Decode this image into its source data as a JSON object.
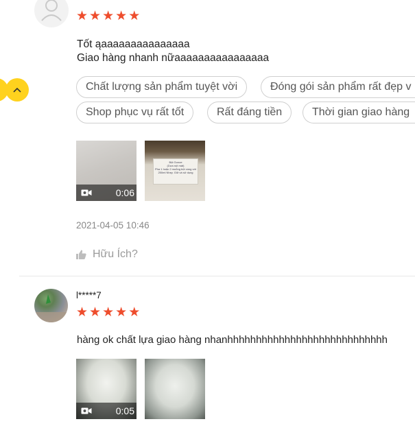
{
  "review1": {
    "rating": 5,
    "text_line1": "Tốt ąaaaaaaaaaaaaaaa",
    "text_line2": "Giao hàng nhanh nữaaaaaaaaaaaaaaaa",
    "tags": [
      "Chất lượng sản phẩm tuyệt vời",
      "Đóng gói sản phẩm rất đẹp v",
      "Shop phục vụ rất tốt",
      "Rất đáng tiền",
      "Thời gian giao hàng"
    ],
    "media": [
      {
        "type": "video",
        "duration": "0:06"
      },
      {
        "type": "image",
        "label_lines": [
          "Bột Gonoe",
          "(Dưa nút mát)",
          "Pha 1 hoặc 2 muỗng bột cùng với",
          "250ml Nhẹy. Giữ và sử dụng"
        ]
      }
    ],
    "date": "2021-04-05 10:46",
    "helpful_label": "Hữu Ích?"
  },
  "review2": {
    "username": "l*****7",
    "rating": 5,
    "text": "hàng ok chất lựa giao hàng nhanhhhhhhhhhhhhhhhhhhhhhhhhhhhh",
    "media": [
      {
        "type": "video",
        "duration": "0:05"
      },
      {
        "type": "image"
      }
    ]
  },
  "colors": {
    "star": "#ee4d2d",
    "scroll_button": "#ffd21e",
    "tag_border": "#cfcfcf",
    "meta_text": "#888888"
  },
  "icons": {
    "star": "star-icon",
    "video": "video-camera-icon",
    "thumbs_up": "thumbs-up-icon",
    "scroll_top": "chevron-up-icon",
    "avatar_default": "user-icon"
  }
}
